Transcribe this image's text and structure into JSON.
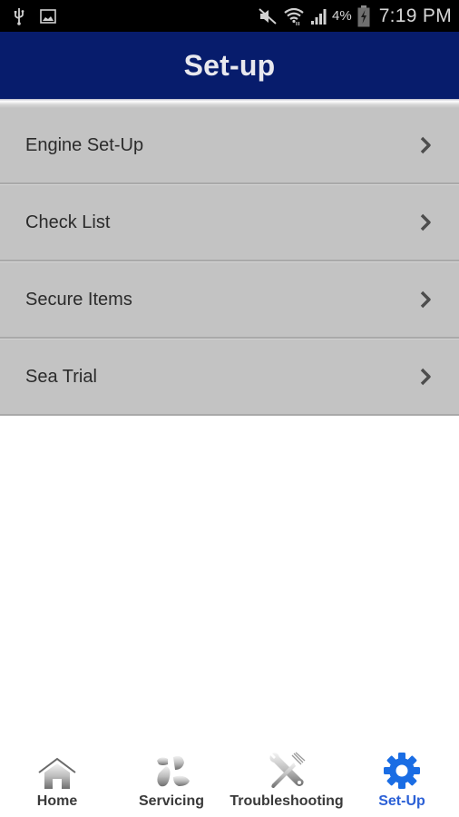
{
  "status_bar": {
    "left_icons": [
      "usb-icon",
      "image-icon"
    ],
    "right_icons": [
      "mute-icon",
      "wifi-icon",
      "signal-icon"
    ],
    "battery_percent": "4%",
    "battery_icon": "battery-charging-icon",
    "time": "7:19 PM"
  },
  "header": {
    "title": "Set-up",
    "background_color": "#071c6c"
  },
  "menu": {
    "items": [
      {
        "label": "Engine Set-Up",
        "icon": "chevron-right-icon"
      },
      {
        "label": "Check List",
        "icon": "chevron-right-icon"
      },
      {
        "label": "Secure Items",
        "icon": "chevron-right-icon"
      },
      {
        "label": "Sea Trial",
        "icon": "chevron-right-icon"
      }
    ]
  },
  "tab_bar": {
    "active_color": "#2b60d6",
    "tabs": [
      {
        "label": "Home",
        "icon": "home-icon",
        "active": false
      },
      {
        "label": "Servicing",
        "icon": "propeller-icon",
        "active": false
      },
      {
        "label": "Troubleshooting",
        "icon": "wrench-fork-icon",
        "active": false
      },
      {
        "label": "Set-Up",
        "icon": "gear-icon",
        "active": true
      }
    ]
  }
}
